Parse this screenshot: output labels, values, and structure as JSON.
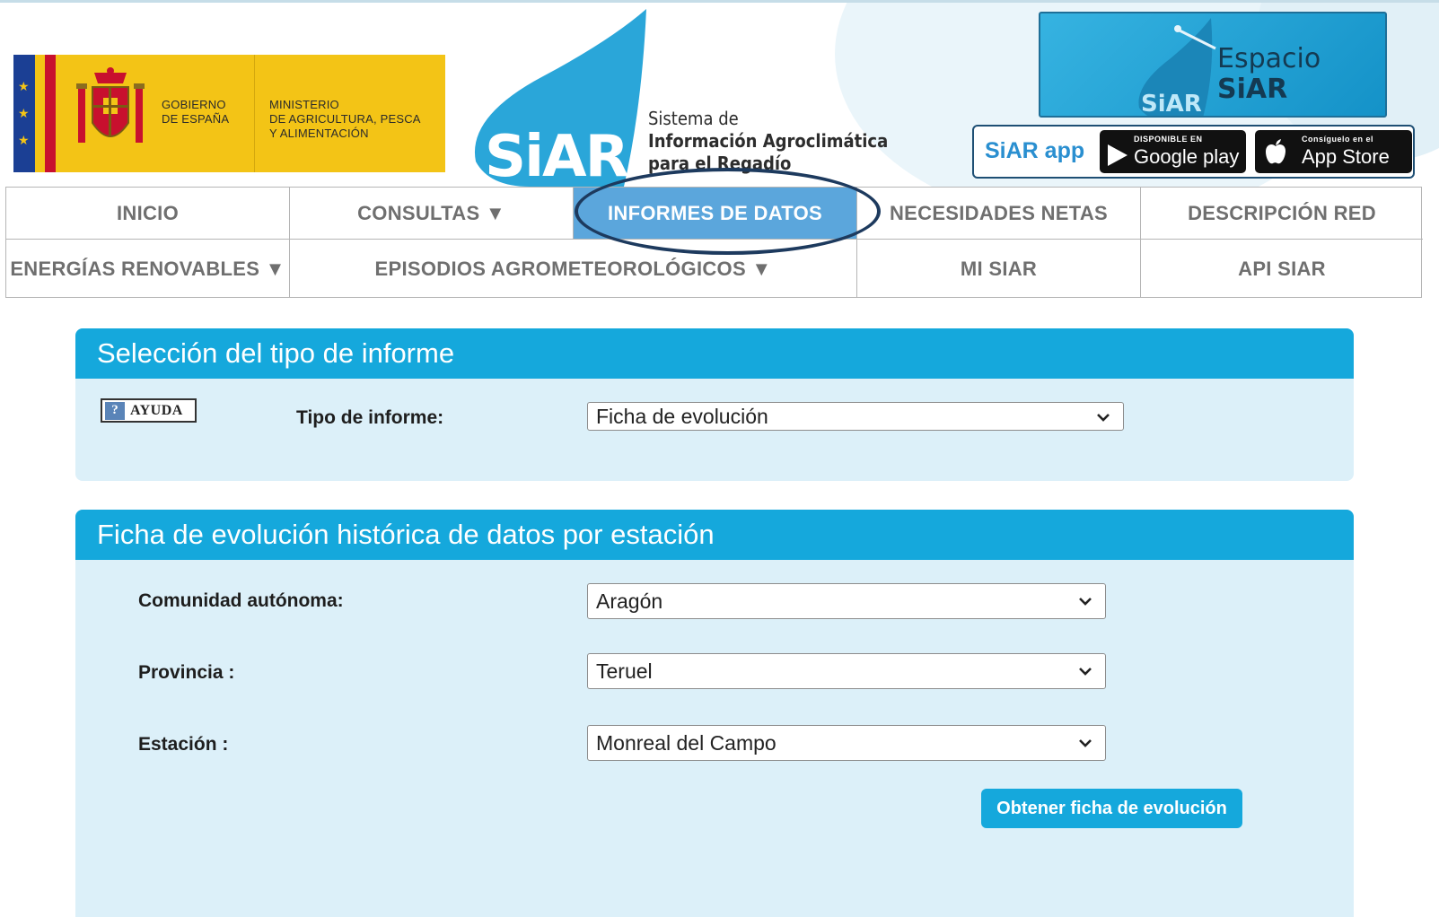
{
  "header": {
    "gov_line1": "GOBIERNO",
    "gov_line2": "DE ESPAÑA",
    "ministry_line1": "MINISTERIO",
    "ministry_line2": "DE AGRICULTURA, PESCA",
    "ministry_line3": "Y ALIMENTACIÓN",
    "siar_logo": "SiAR",
    "siar_tagline_1": "Sistema de",
    "siar_tagline_2": "Información Agroclimática",
    "siar_tagline_3": "para el Regadío",
    "espacio_line1": "Espacio",
    "espacio_line2": "SiAR",
    "espacio_logo_small": "SiAR",
    "app_label": "SiAR app",
    "google_small": "DISPONIBLE EN",
    "google_big": "Google play",
    "apple_small": "Consíguelo en el",
    "apple_big": "App Store"
  },
  "nav": {
    "row1": [
      "INICIO",
      "CONSULTAS ▼",
      "INFORMES DE DATOS",
      "NECESIDADES NETAS",
      "DESCRIPCIÓN RED"
    ],
    "row2": [
      "ENERGÍAS RENOVABLES ▼",
      "EPISODIOS AGROMETEOROLÓGICOS ▼",
      "MI SIAR",
      "API SIAR"
    ],
    "active": "INFORMES DE DATOS"
  },
  "report_selection": {
    "title": "Selección del tipo de informe",
    "help_label": "AYUDA",
    "help_icon": "?",
    "type_label": "Tipo de informe:",
    "type_value": "Ficha de evolución"
  },
  "evolution_form": {
    "title": "Ficha de evolución histórica de datos por estación",
    "community_label": "Comunidad autónoma:",
    "community_value": "Aragón",
    "province_label": "Provincia :",
    "province_value": "Teruel",
    "station_label": "Estación :",
    "station_value": "Monreal del Campo",
    "submit_label": "Obtener ficha de evolución"
  },
  "colors": {
    "accent": "#15a8dc",
    "nav_active": "#5ba6dc",
    "panel_bg": "#dcf0f9",
    "ring": "#1d3a5e"
  }
}
